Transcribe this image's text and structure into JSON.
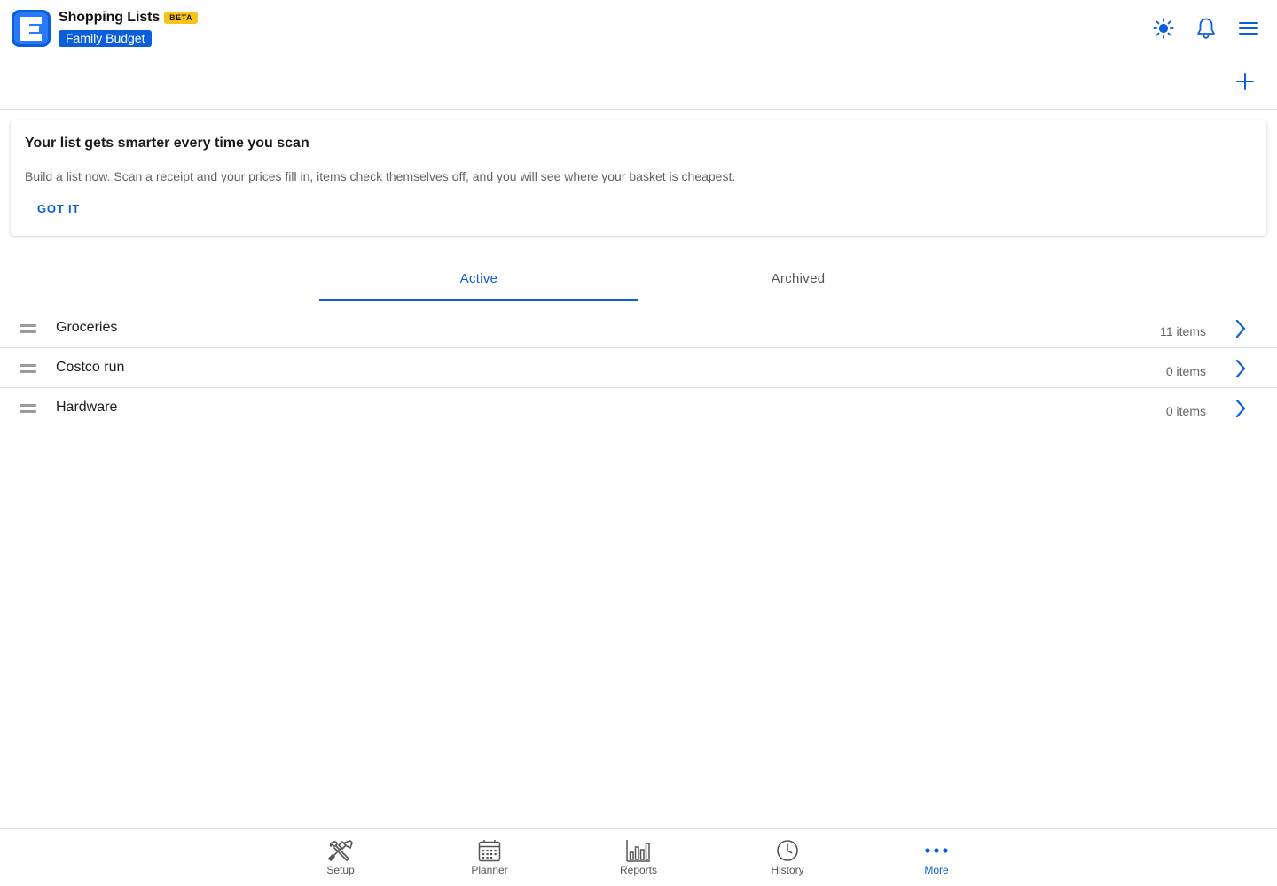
{
  "header": {
    "title": "Shopping Lists",
    "badge": "BETA",
    "budget": "Family Budget",
    "logo_letter": "E"
  },
  "card": {
    "title": "Your list gets smarter every time you scan",
    "text": "Build a list now. Scan a receipt and your prices fill in, items check themselves off, and you will see where your basket is cheapest.",
    "action": "GOT IT"
  },
  "tabs": [
    {
      "label": "Active",
      "active": true
    },
    {
      "label": "Archived",
      "active": false
    }
  ],
  "lists": [
    {
      "name": "Groceries",
      "count": "11 items"
    },
    {
      "name": "Costco run",
      "count": "0 items"
    },
    {
      "name": "Hardware",
      "count": "0 items"
    }
  ],
  "nav": [
    {
      "label": "Setup",
      "icon": "tools-icon"
    },
    {
      "label": "Planner",
      "icon": "calendar-icon"
    },
    {
      "label": "Reports",
      "icon": "bar-chart-icon"
    },
    {
      "label": "History",
      "icon": "clock-icon"
    },
    {
      "label": "More",
      "icon": "more-dots-icon",
      "active": true
    }
  ],
  "colors": {
    "accent": "#0a5fd9",
    "badge": "#f7c316",
    "divider": "#dcdcdc"
  }
}
